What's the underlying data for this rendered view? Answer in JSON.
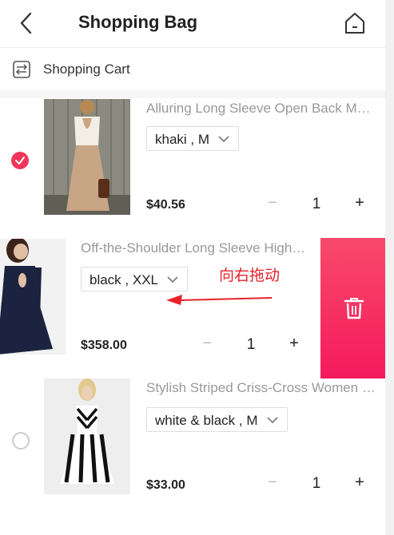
{
  "header": {
    "title": "Shopping Bag"
  },
  "cart_section": {
    "label": "Shopping Cart"
  },
  "items": [
    {
      "name": "Alluring Long Sleeve Open Back Maxi Dress",
      "variant": "khaki , M",
      "price": "$40.56",
      "qty": "1",
      "minus": "−",
      "plus": "+",
      "selected": true
    },
    {
      "name": "Off-the-Shoulder Long Sleeve High Low Dress",
      "variant": "black , XXL",
      "price": "$358.00",
      "qty": "1",
      "minus": "−",
      "plus": "+",
      "selected": null
    },
    {
      "name": "Stylish Striped Criss-Cross Women Dress",
      "variant": "white & black , M",
      "price": "$33.00",
      "qty": "1",
      "minus": "−",
      "plus": "+",
      "selected": false
    }
  ],
  "annotation": {
    "text": "向右拖动"
  },
  "colors": {
    "accent": "#f0365a",
    "delete_bg": "#f72a60",
    "annotation": "#e8222a"
  },
  "icons": {
    "back": "chevron-left-icon",
    "home": "home-icon",
    "cart": "cart-list-icon",
    "delete": "trash-icon",
    "dropdown": "chevron-down-icon"
  }
}
